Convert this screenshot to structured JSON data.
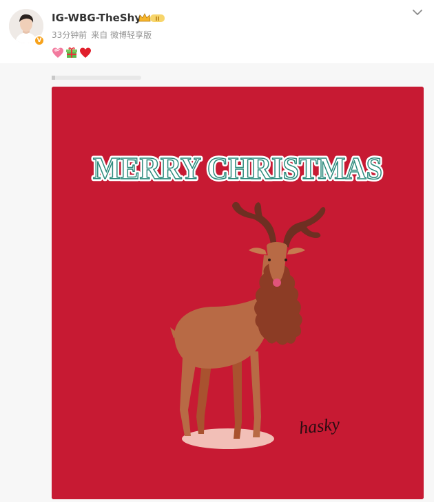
{
  "post": {
    "author": {
      "name": "IG-WBG-TheShy",
      "verified_badge": "V"
    },
    "meta": {
      "time": "33分钟前",
      "source": "来自 微博轻享版"
    },
    "emojis": [
      "heart-with-ribbon-emoji",
      "gift-emoji",
      "red-heart-emoji"
    ],
    "image": {
      "headline": "MERRY CHRISTMAS",
      "signature": "hasky",
      "background_color": "#c71a33"
    }
  },
  "colors": {
    "accent_gold": "#f7a21b",
    "text_primary": "#333333",
    "text_secondary": "#939393"
  }
}
